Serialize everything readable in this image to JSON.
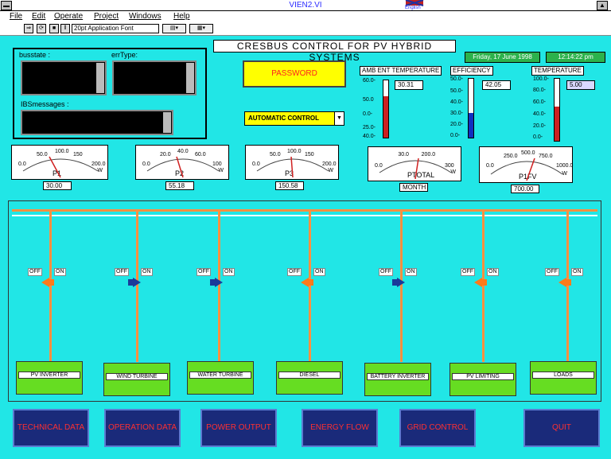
{
  "window": {
    "title": "VIEN2.VI",
    "lang_label": "English"
  },
  "menu": [
    "File",
    "Edit",
    "Operate",
    "Project",
    "Windows",
    "Help"
  ],
  "toolbar": {
    "font": "20pt Application Font"
  },
  "status_panel": {
    "busstate_label": "busstate :",
    "errtype_label": "errType:",
    "ibsmessages_label": "IBSmessages :"
  },
  "main_title": "CRESBUS CONTROL FOR PV HYBRID SYSTEMS",
  "date": "Friday, 17 June 1998",
  "time": "12:14:22 pm",
  "password_label": "PASSWORD",
  "control_mode": "AUTOMATIC CONTROL",
  "ambient": {
    "label": "AMB ENT TEMPERATURE",
    "value": "30.31",
    "ticks": [
      "60.0-",
      "50.0",
      "0.0-",
      "25.0-",
      "40.0-"
    ],
    "fill_fraction": 0.72,
    "color": "#cc2020"
  },
  "battery_efficiency": {
    "label": "EFFICIENCY",
    "value": "42.05",
    "ticks": [
      "50.0-",
      "60.0-",
      "50.0-",
      "40.0-",
      "30.0-",
      "20.0-",
      "10.0-",
      "0.0-"
    ],
    "fill_fraction": 0.42,
    "color": "#1030c0"
  },
  "temperature": {
    "label": "TEMPERATURE",
    "value": "5.00",
    "ticks": [
      "100.0-",
      "80.0-",
      "60.0-",
      "40.0-",
      "20.0-",
      "0.0-"
    ],
    "fill_fraction": 0.55,
    "color": "#cc2020"
  },
  "meters": [
    {
      "name": "P1",
      "ticks": [
        "0.0",
        "50.0",
        "100.0",
        "150",
        "200.0"
      ],
      "value": "30.00",
      "unit": "W"
    },
    {
      "name": "P2",
      "ticks": [
        "0.0",
        "20.0",
        "40.0",
        "60.0",
        "100"
      ],
      "value": "55.18",
      "unit": "W"
    },
    {
      "name": "P3",
      "ticks": [
        "0.0",
        "50.0",
        "100.0",
        "150",
        "200.0"
      ],
      "value": "150.58",
      "unit": "W"
    },
    {
      "name": "PTOTAL",
      "ticks": [
        "0.0",
        "30.0",
        "200.0",
        "300"
      ],
      "value": "MONTH",
      "unit": "W"
    },
    {
      "name": "P1FV",
      "ticks": [
        "0.0",
        "250.0",
        "500.0",
        "750.0",
        "1000.0"
      ],
      "value": "700.00",
      "unit": "W"
    }
  ],
  "switches": [
    {
      "off": "OFF",
      "on": "ON",
      "state": "on",
      "source": "PV INVERTER"
    },
    {
      "off": "OFF",
      "on": "ON",
      "state": "off",
      "source": "WIND TURBINE"
    },
    {
      "off": "OFF",
      "on": "ON",
      "state": "off",
      "source": "WATER TURBINE"
    },
    {
      "off": "OFF",
      "on": "ON",
      "state": "on",
      "source": "DIESEL"
    },
    {
      "off": "OFF",
      "on": "ON",
      "state": "off",
      "source": "BATTERY INVERTER"
    },
    {
      "off": "OFF",
      "on": "ON",
      "state": "on",
      "source": "PV LIMITING"
    },
    {
      "off": "OFF",
      "on": "ON",
      "state": "on",
      "source": "LOADS"
    }
  ],
  "nav_buttons": [
    "TECHNICAL DATA",
    "OPERATION DATA",
    "POWER OUTPUT",
    "ENERGY FLOW",
    "GRID CONTROL",
    "QUIT"
  ],
  "colors": {
    "background": "#21e6e6",
    "bus": "#ff9040",
    "source": "#66dd22",
    "nav_bg": "#1a2a7a",
    "nav_text": "#ff3030"
  }
}
